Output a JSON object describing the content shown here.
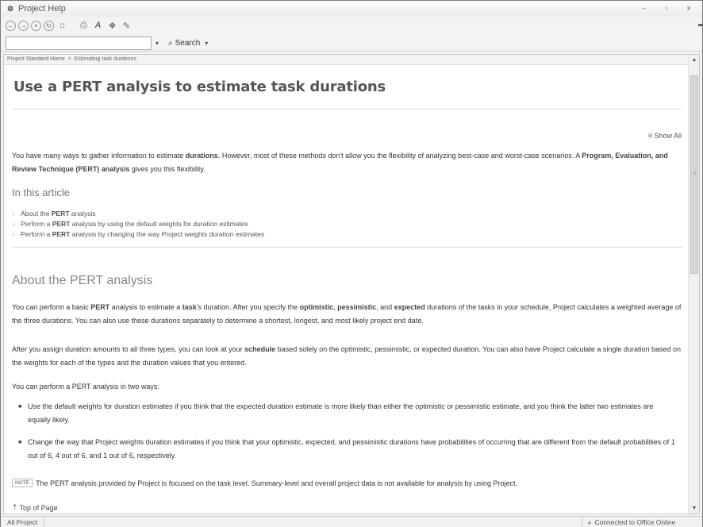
{
  "window": {
    "title": "Project Help",
    "app_icon": "help-book-icon",
    "buttons": {
      "minimize": "–",
      "maximize": "▫",
      "close": "x"
    }
  },
  "toolbar": {
    "icons": [
      "back-icon",
      "forward-icon",
      "stop-icon",
      "refresh-icon",
      "home-icon",
      "print-icon",
      "text-size-icon",
      "toc-icon",
      "pin-icon"
    ],
    "glyphs": {
      "back": "←",
      "forward": "→",
      "stop": "×",
      "refresh": "↻",
      "home": "⌂",
      "print": "⎙",
      "text_size": "A",
      "toc": "❖",
      "pin": "✎",
      "grip": "▬"
    }
  },
  "search": {
    "input_value": "",
    "scope_arrow": "▾",
    "button_icon": "⌕",
    "button_label": "Search",
    "button_arrow": "▾"
  },
  "breadcrumb": {
    "home": "Project Standard Home",
    "separator": ">",
    "current": "Estimating task durations"
  },
  "scrollbar": {
    "up": "▲",
    "down": "▼",
    "grip": "≡"
  },
  "article": {
    "title": "Use a PERT analysis to estimate task durations",
    "show_all_box": "⊞",
    "show_all": "Show All",
    "intro": [
      {
        "text": "You have many ways to gather information to estimate ",
        "bold": false
      },
      {
        "text": "durations",
        "bold": true
      },
      {
        "text": ". However, most of these methods don't allow you the flexibility of analyzing best-case and worst-case scenarios. A ",
        "bold": false
      },
      {
        "text": "Program, Evaluation, and Review Technique (PERT) analysis",
        "bold": true
      },
      {
        "text": " gives you this flexibility.",
        "bold": false
      }
    ],
    "in_this_article": "In this article",
    "toc_arrow": "↓",
    "toc": [
      [
        {
          "text": "About the ",
          "bold": false
        },
        {
          "text": "PERT",
          "bold": true
        },
        {
          "text": " analysis",
          "bold": false
        }
      ],
      [
        {
          "text": "Perform a ",
          "bold": false
        },
        {
          "text": "PERT",
          "bold": true
        },
        {
          "text": " analysis by using the default weights for duration estimates",
          "bold": false
        }
      ],
      [
        {
          "text": "Perform a ",
          "bold": false
        },
        {
          "text": "PERT",
          "bold": true
        },
        {
          "text": " analysis by changing the way Project weights duration estimates",
          "bold": false
        }
      ]
    ],
    "section_title": "About the PERT analysis",
    "para1": [
      {
        "text": "You can perform a basic ",
        "bold": false
      },
      {
        "text": "PERT",
        "bold": true
      },
      {
        "text": " analysis to estimate a ",
        "bold": false
      },
      {
        "text": "task",
        "bold": true
      },
      {
        "text": "'s duration. After you specify the ",
        "bold": false
      },
      {
        "text": "optimistic",
        "bold": true
      },
      {
        "text": ", ",
        "bold": false
      },
      {
        "text": "pessimistic",
        "bold": true
      },
      {
        "text": ", and ",
        "bold": false
      },
      {
        "text": "expected",
        "bold": true
      },
      {
        "text": " durations of the tasks in your schedule, Project calculates a weighted average of the three durations. You can also use these durations separately to determine a shortest, longest, and most likely project end date.",
        "bold": false
      }
    ],
    "para2": [
      {
        "text": "After you assign duration amounts to all three types, you can look at your ",
        "bold": false
      },
      {
        "text": "schedule",
        "bold": true
      },
      {
        "text": " based solely on the optimistic, pessimistic, or expected duration. You can also have Project calculate a single duration based on the weights for each of the types and the duration values that you entered.",
        "bold": false
      }
    ],
    "para3": "You can perform a PERT analysis in two ways:",
    "bullet_glyph": "■",
    "bullets": [
      "Use the default weights for duration estimates if you think that the expected duration estimate is more likely than either the optimistic or pessimistic estimate, and you think the latter two estimates are equally likely.",
      "Change the way that Project weights duration estimates if you think that your optimistic, expected, and pessimistic durations have probabilities of occurring that are different from the default probabilities of 1 out of 6, 4 out of 6, and 1 out of 6, respectively."
    ],
    "note_tag": "NOTE",
    "note_text": "The PERT analysis provided by Project is focused on the task level. Summary-level and overall project data is not available for analysis by using Project.",
    "top_of_page_icon": "⇡",
    "top_of_page": "Top of Page"
  },
  "status": {
    "left": "All Project",
    "right_icon": "◕",
    "right": "Connected to Office Online"
  }
}
